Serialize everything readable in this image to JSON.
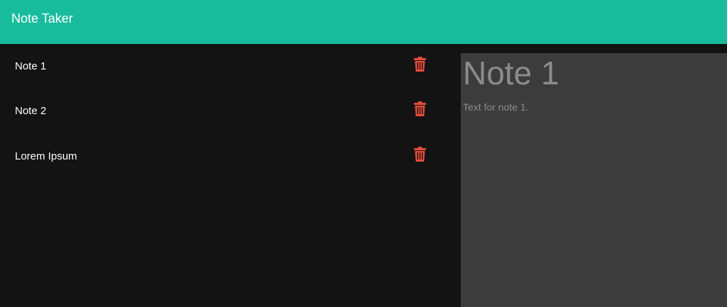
{
  "app": {
    "title": "Note Taker"
  },
  "colors": {
    "navbar": "#18bc9c",
    "page_background": "#131313",
    "editor_background": "#3c3c3c",
    "delete_icon": "#e74c3c",
    "editor_text": "#8c8c8c"
  },
  "notes": [
    {
      "title": "Note 1",
      "icon": "trash-icon"
    },
    {
      "title": "Note 2",
      "icon": "trash-icon"
    },
    {
      "title": "Lorem Ipsum",
      "icon": "trash-icon"
    }
  ],
  "editor": {
    "title": "Note 1",
    "text": "Text for note 1."
  }
}
